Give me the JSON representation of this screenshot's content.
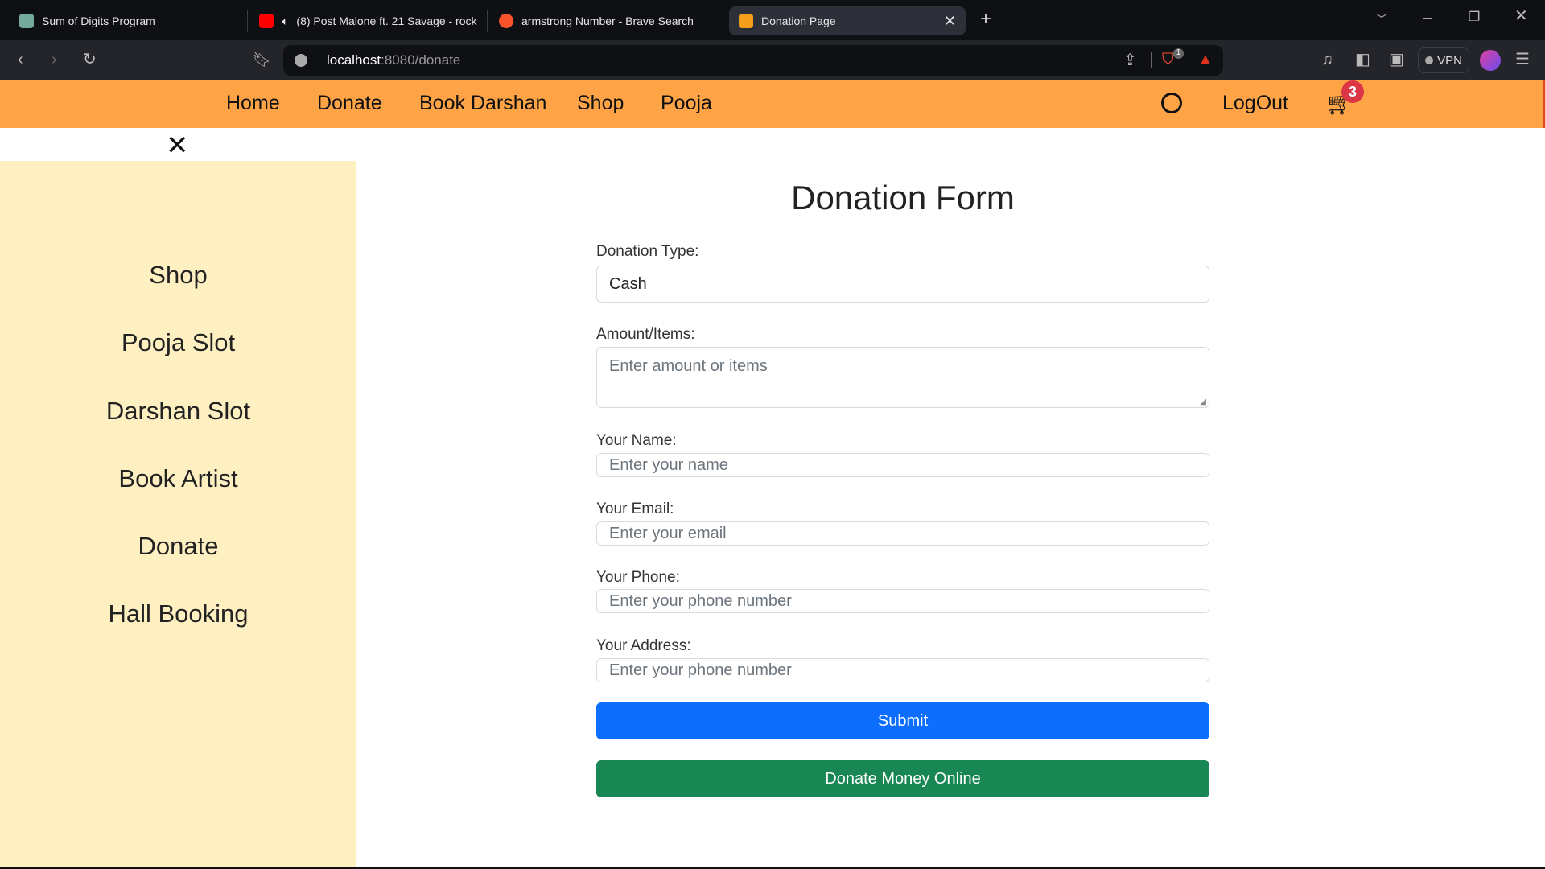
{
  "browser": {
    "tabs": [
      {
        "title": "Sum of Digits Program",
        "favicon": "chatgpt-icon",
        "color": "#74aa9c"
      },
      {
        "title": "(8) Post Malone ft. 21 Savage - rock",
        "favicon": "youtube-icon",
        "color": "#ff0000"
      },
      {
        "title": "armstrong Number - Brave Search",
        "favicon": "brave-search-icon",
        "color": "#fb542b"
      },
      {
        "title": "Donation Page",
        "favicon": "temple-icon",
        "color": "#f59e1b"
      }
    ],
    "url_host": "localhost",
    "url_path": ":8080/donate",
    "shield_count": "1",
    "vpn_label": "VPN"
  },
  "nav": {
    "items": [
      "Home",
      "Donate",
      "Book Darshan",
      "Shop",
      "Pooja"
    ],
    "logout": "LogOut",
    "cart_count": "3"
  },
  "sidebar": {
    "items": [
      "Shop",
      "Pooja Slot",
      "Darshan Slot",
      "Book Artist",
      "Donate",
      "Hall Booking"
    ]
  },
  "form": {
    "title": "Donation Form",
    "type_label": "Donation Type:",
    "type_value": "Cash",
    "amount_label": "Amount/Items:",
    "amount_placeholder": "Enter amount or items",
    "name_label": "Your Name:",
    "name_placeholder": "Enter your name",
    "email_label": "Your Email:",
    "email_placeholder": "Enter your email",
    "phone_label": "Your Phone:",
    "phone_placeholder": "Enter your phone number",
    "address_label": "Your Address:",
    "address_placeholder": "Enter your phone number",
    "submit": "Submit",
    "donate_online": "Donate Money Online"
  },
  "colors": {
    "nav": "#ffa446",
    "sidebar": "#fff0c2",
    "submit": "#0d6efd",
    "donate": "#198754"
  }
}
